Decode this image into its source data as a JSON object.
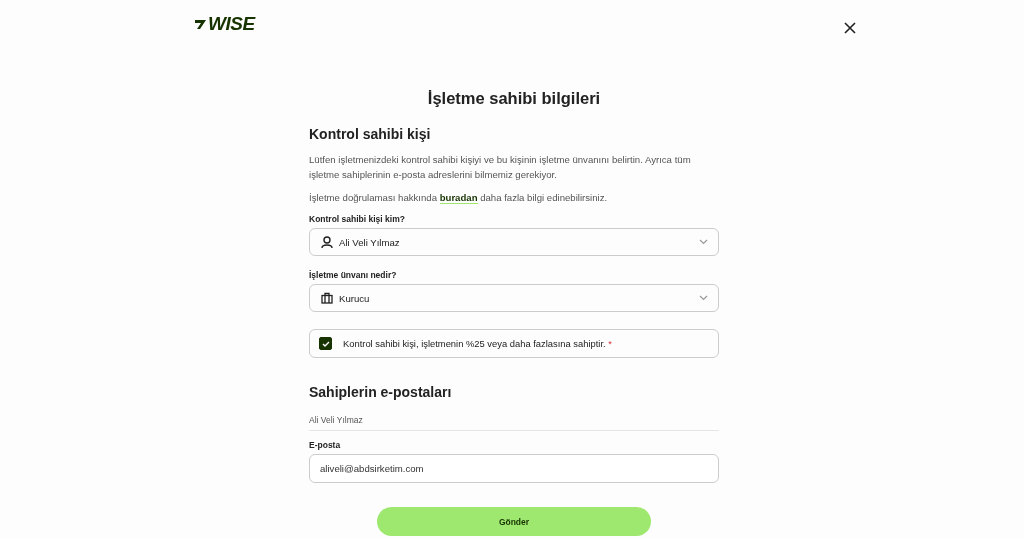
{
  "header": {
    "logo": "WISE"
  },
  "title": "İşletme sahibi bilgileri",
  "section_1": {
    "heading": "Kontrol sahibi kişi",
    "description": "Lütfen işletmenizdeki kontrol sahibi kişiyi ve bu kişinin işletme ünvanını belirtin. Ayrıca tüm işletme sahiplerinin e-posta adreslerini bilmemiz gerekiyor.",
    "info": {
      "before": "İşletme doğrulaması hakkında ",
      "link": "buradan",
      "after": " daha fazla bilgi edinebilirsiniz."
    },
    "fields": [
      {
        "label": "Kontrol sahibi kişi kim?",
        "value": "Ali Veli Yılmaz"
      },
      {
        "label": "İşletme ünvanı nedir?",
        "value": "Kurucu"
      }
    ],
    "checkbox": {
      "label": "Kontrol sahibi kişi, işletmenin %25 veya daha fazlasına sahiptir.",
      "required_mark": "*",
      "checked": true
    }
  },
  "section_2": {
    "heading": "Sahiplerin e-postaları",
    "owner": "Ali Veli Yılmaz",
    "email_label": "E-posta",
    "email_value": "aliveli@abdsirketim.com"
  },
  "submit": "Gönder"
}
